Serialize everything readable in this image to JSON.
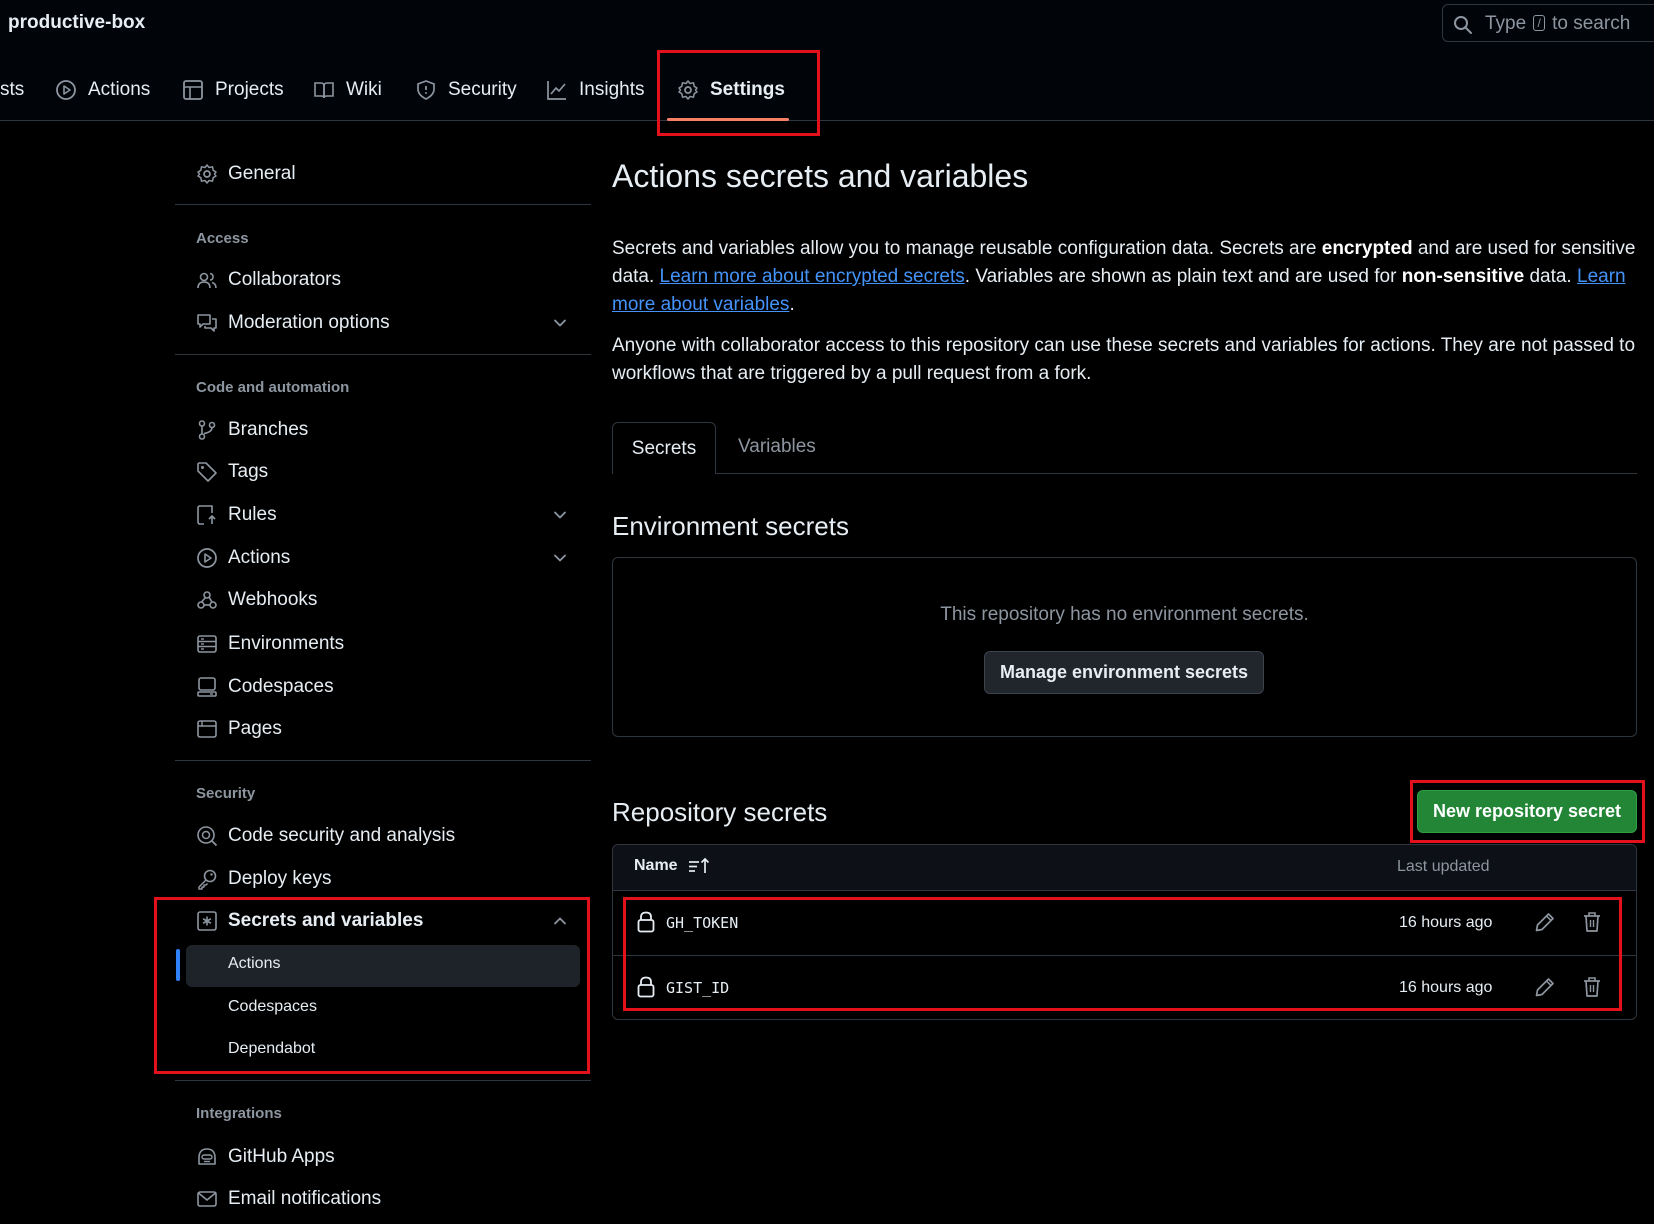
{
  "header": {
    "repo_name": "productive-box",
    "search": {
      "prefix": "Type",
      "key": "/",
      "suffix": "to search"
    }
  },
  "repo_tabs": [
    {
      "label": "sts",
      "icon": ""
    },
    {
      "label": "Actions",
      "icon": "play-circle-icon"
    },
    {
      "label": "Projects",
      "icon": "table-icon"
    },
    {
      "label": "Wiki",
      "icon": "book-icon"
    },
    {
      "label": "Security",
      "icon": "shield-icon"
    },
    {
      "label": "Insights",
      "icon": "graph-icon"
    },
    {
      "label": "Settings",
      "icon": "gear-icon",
      "active": true
    }
  ],
  "sidebar": {
    "general": "General",
    "sections": {
      "access": {
        "heading": "Access",
        "items": [
          "Collaborators",
          "Moderation options"
        ]
      },
      "code": {
        "heading": "Code and automation",
        "items": [
          "Branches",
          "Tags",
          "Rules",
          "Actions",
          "Webhooks",
          "Environments",
          "Codespaces",
          "Pages"
        ]
      },
      "security": {
        "heading": "Security",
        "items": [
          "Code security and analysis",
          "Deploy keys",
          "Secrets and variables"
        ],
        "subitems": [
          "Actions",
          "Codespaces",
          "Dependabot"
        ]
      },
      "integrations": {
        "heading": "Integrations",
        "items": [
          "GitHub Apps",
          "Email notifications"
        ]
      }
    }
  },
  "main": {
    "title": "Actions secrets and variables",
    "desc1": {
      "t1": "Secrets and variables allow you to manage reusable configuration data. Secrets are ",
      "b1": "encrypted",
      "t2": " and are used for sensitive data. ",
      "link1": "Learn more about encrypted secrets",
      "t3": ". Variables are shown as plain text and are used for ",
      "b2": "non-sensitive",
      "t4": " data. ",
      "link2": "Learn more about variables",
      "t5": "."
    },
    "desc2": "Anyone with collaborator access to this repository can use these secrets and variables for actions. They are not passed to workflows that are triggered by a pull request from a fork.",
    "tabs": [
      "Secrets",
      "Variables"
    ],
    "env": {
      "heading": "Environment secrets",
      "empty": "This repository has no environment secrets.",
      "button": "Manage environment secrets"
    },
    "repo": {
      "heading": "Repository secrets",
      "button": "New repository secret",
      "columns": {
        "name": "Name",
        "updated": "Last updated"
      },
      "rows": [
        {
          "name": "GH_TOKEN",
          "updated": "16 hours ago"
        },
        {
          "name": "GIST_ID",
          "updated": "16 hours ago"
        }
      ]
    }
  },
  "colors": {
    "background": "#000000",
    "accent_link": "#4493f8",
    "primary_button": "#238636",
    "highlight_box": "#e3111b",
    "tab_underline": "#f78166"
  }
}
